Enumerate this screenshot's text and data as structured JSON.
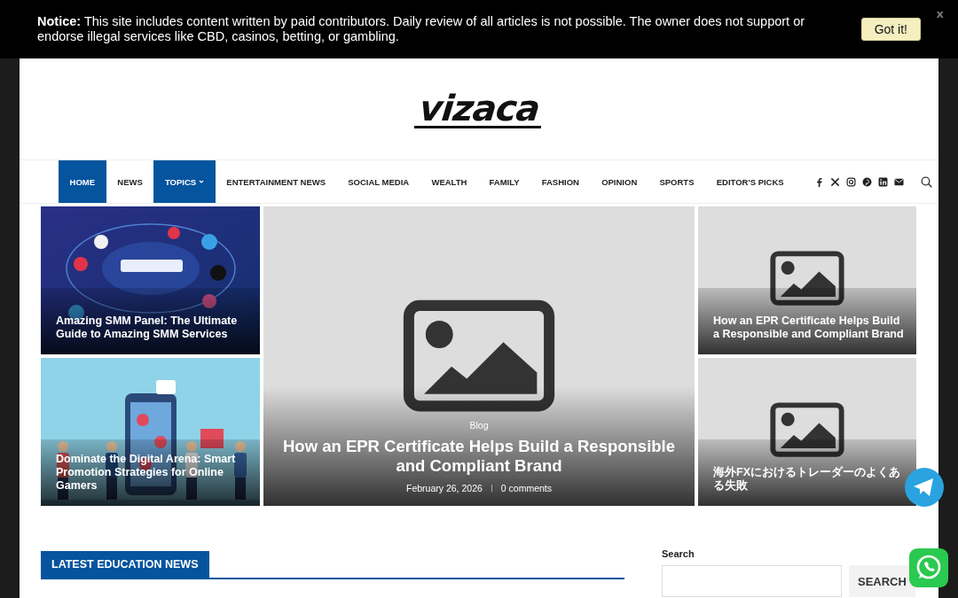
{
  "notice": {
    "text": "**Notice:** This site includes content written by paid contributors. Daily review of all articles is not possible. The owner does not support or endorse illegal services like CBD, casinos, betting, or gambling.",
    "button": "Got it!",
    "close": "x"
  },
  "logo": {
    "text": "vizaca"
  },
  "nav": {
    "items": [
      {
        "label": "HOME",
        "selected": true
      },
      {
        "label": "NEWS",
        "selected": false
      },
      {
        "label": "TOPICS",
        "selected": true,
        "dropdown": true
      },
      {
        "label": "ENTERTAINMENT NEWS",
        "selected": false
      },
      {
        "label": "SOCIAL MEDIA",
        "selected": false
      },
      {
        "label": "WEALTH",
        "selected": false
      },
      {
        "label": "FAMILY",
        "selected": false
      },
      {
        "label": "FASHION",
        "selected": false
      },
      {
        "label": "OPINION",
        "selected": false
      },
      {
        "label": "SPORTS",
        "selected": false
      },
      {
        "label": "EDITOR'S PICKS",
        "selected": false
      }
    ]
  },
  "featured": [
    {
      "title": "Amazing SMM Panel: The Ultimate Guide to Amazing SMM Services"
    },
    {
      "kind": "big",
      "category": "Blog",
      "title": "How an EPR Certificate Helps Build a Responsible and Compliant Brand",
      "date": "February 26, 2026",
      "comments": "0 comments"
    },
    {
      "kind": "placeholder",
      "title": "How an EPR Certificate Helps Build a Responsible and Compliant Brand"
    },
    {
      "title": "Dominate the Digital Arena: Smart Promotion Strategies for Online Gamers"
    },
    {
      "kind": "placeholder",
      "title": "海外FXにおけるトレーダーのよくある失敗"
    }
  ],
  "section": {
    "heading": "LATEST EDUCATION NEWS"
  },
  "sidebar": {
    "label": "Search",
    "button": "SEARCH"
  }
}
